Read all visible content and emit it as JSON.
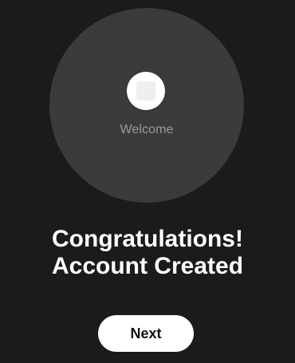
{
  "hero": {
    "welcome_text": "Welcome",
    "logo_icon": "app-logo-icon"
  },
  "message": {
    "line1": "Congratulations!",
    "line2": "Account Created"
  },
  "actions": {
    "next_label": "Next"
  },
  "colors": {
    "background": "#1b1b1b",
    "hero_circle": "#3b3b3b",
    "primary_text": "#ffffff",
    "secondary_text": "#9a9a9a",
    "button_background": "#ffffff",
    "button_text": "#111111"
  }
}
